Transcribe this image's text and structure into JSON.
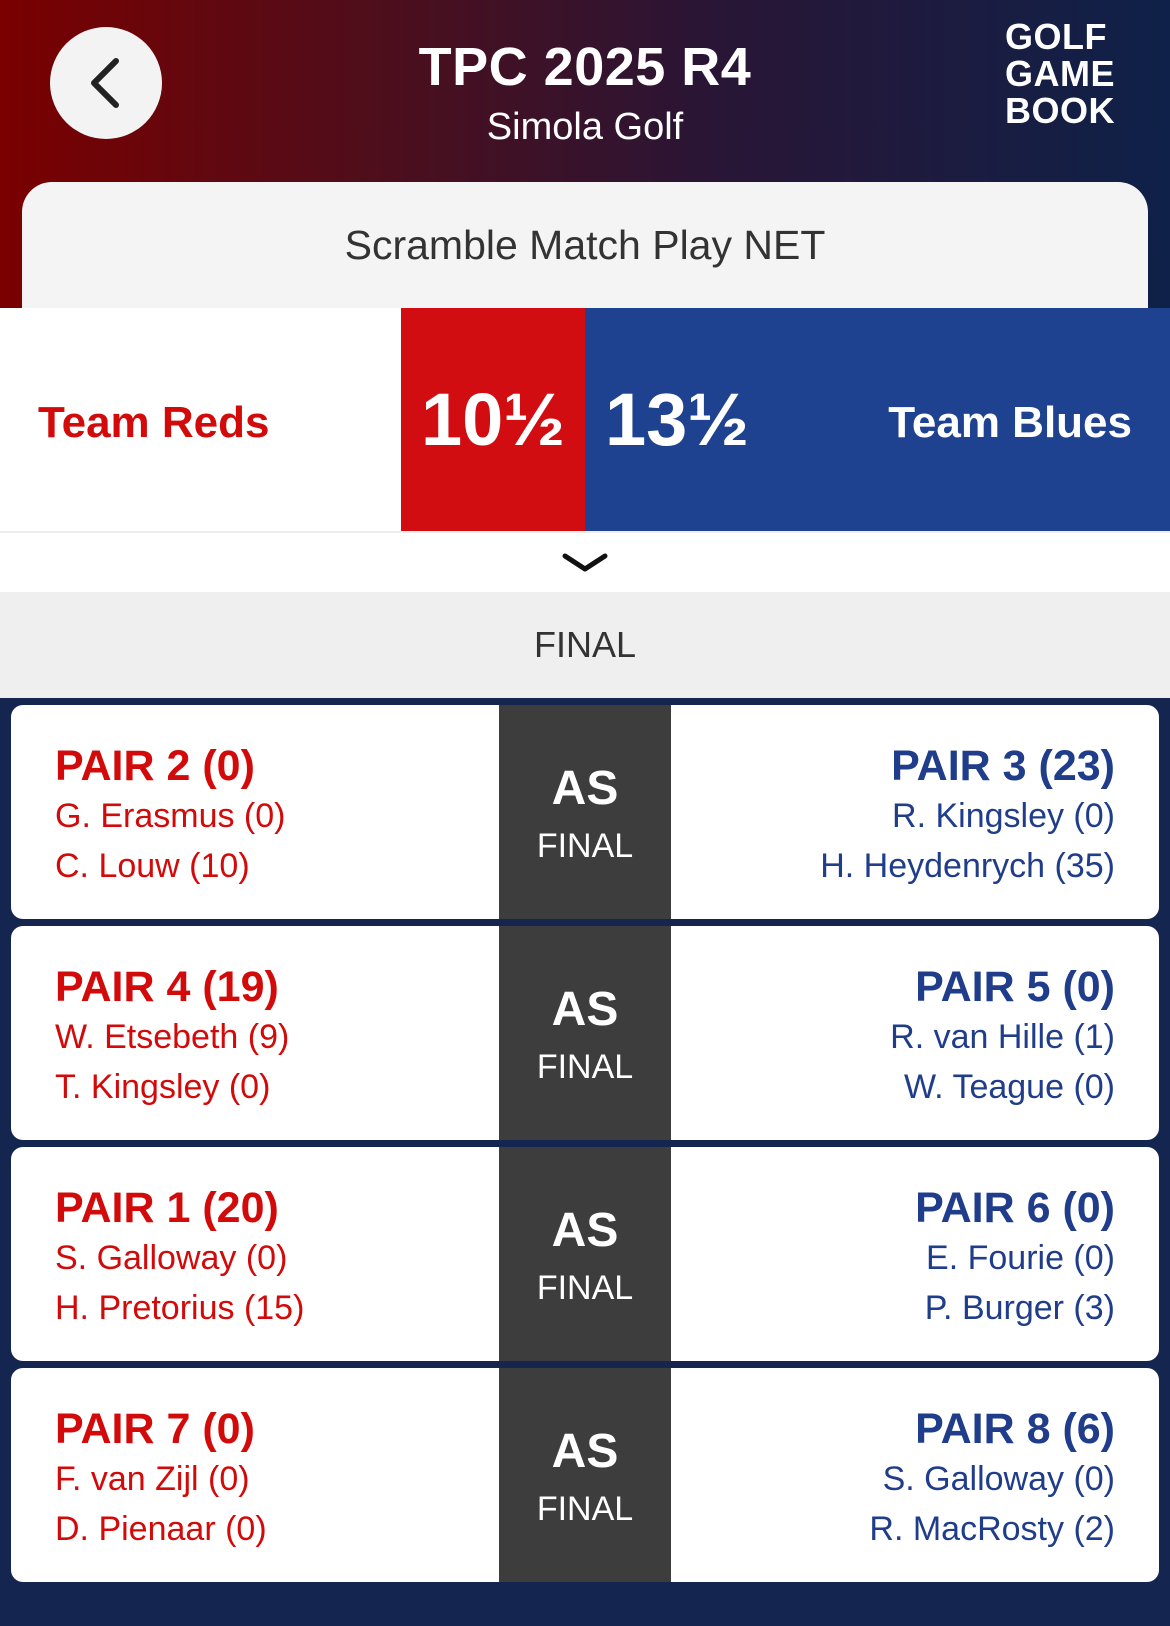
{
  "header": {
    "title": "TPC 2025 R4",
    "subtitle": "Simola Golf",
    "logo": [
      "GOLF",
      "GAME",
      "BOOK"
    ]
  },
  "format": "Scramble Match Play NET",
  "teams": {
    "red": {
      "name": "Team Reds",
      "score": "10½",
      "color": "#d10d12"
    },
    "blue": {
      "name": "Team Blues",
      "score": "13½",
      "color": "#1f4290"
    }
  },
  "status": "FINAL",
  "matches": [
    {
      "left": {
        "pair": "PAIR 2 (0)",
        "players": [
          "G. Erasmus (0)",
          "C. Louw (10)"
        ]
      },
      "result": "AS",
      "state": "FINAL",
      "right": {
        "pair": "PAIR 3 (23)",
        "players": [
          "R. Kingsley (0)",
          "H. Heydenrych (35)"
        ]
      }
    },
    {
      "left": {
        "pair": "PAIR 4 (19)",
        "players": [
          "W. Etsebeth (9)",
          "T. Kingsley (0)"
        ]
      },
      "result": "AS",
      "state": "FINAL",
      "right": {
        "pair": "PAIR 5 (0)",
        "players": [
          "R. van Hille (1)",
          "W. Teague (0)"
        ]
      }
    },
    {
      "left": {
        "pair": "PAIR 1 (20)",
        "players": [
          "S. Galloway (0)",
          "H. Pretorius (15)"
        ]
      },
      "result": "AS",
      "state": "FINAL",
      "right": {
        "pair": "PAIR 6 (0)",
        "players": [
          "E. Fourie (0)",
          "P. Burger (3)"
        ]
      }
    },
    {
      "left": {
        "pair": "PAIR 7 (0)",
        "players": [
          "F. van Zijl (0)",
          "D. Pienaar (0)"
        ]
      },
      "result": "AS",
      "state": "FINAL",
      "right": {
        "pair": "PAIR 8 (6)",
        "players": [
          "S. Galloway (0)",
          "R. MacRosty (2)"
        ]
      }
    }
  ]
}
